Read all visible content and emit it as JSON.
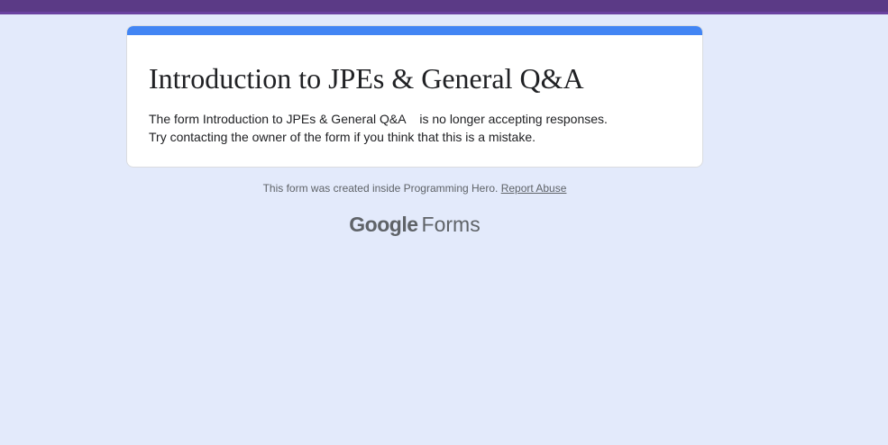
{
  "form": {
    "title": "Introduction to JPEs & General Q&A",
    "message_line1": "The form Introduction to JPEs & General Q&A    is no longer accepting responses.",
    "message_line2": "Try contacting the owner of the form if you think that this is a mistake."
  },
  "footer": {
    "created_text": "This form was created inside Programming Hero.",
    "report_link": "Report Abuse"
  },
  "brand": {
    "google": "Google",
    "product": "Forms"
  },
  "colors": {
    "background": "#e3eafb",
    "accent": "#4285f4",
    "top_strip": "#5b3a86"
  }
}
